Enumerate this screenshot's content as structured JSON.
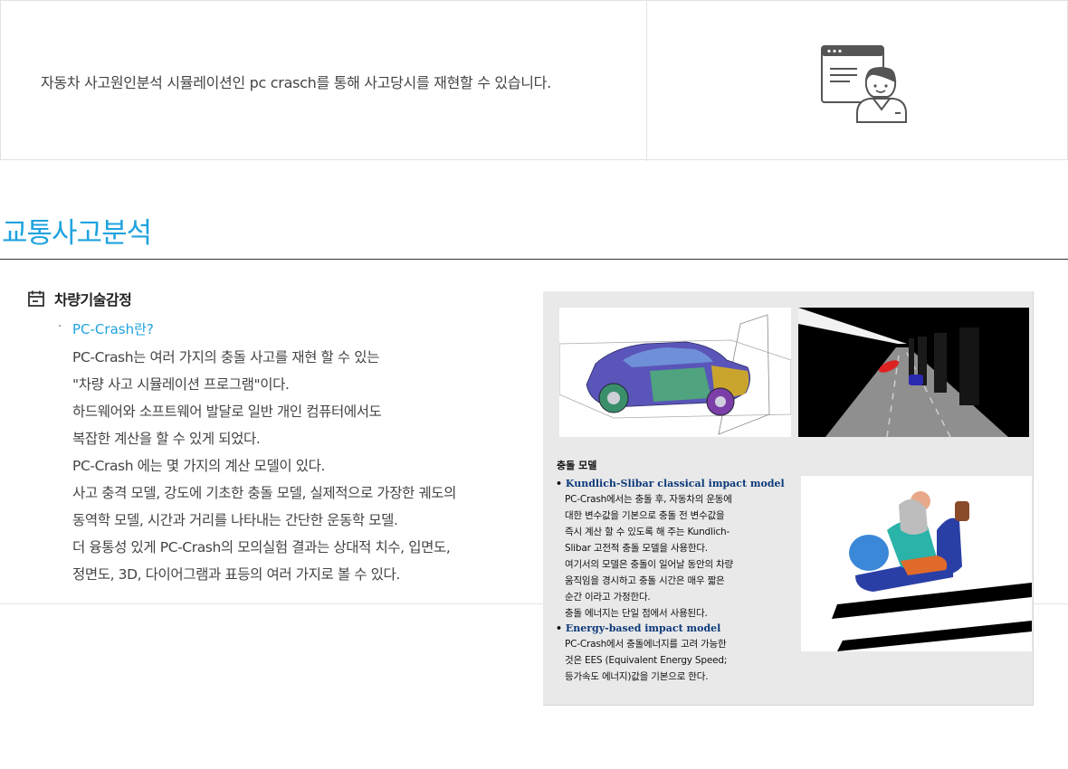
{
  "intro": {
    "text": "자동차 사고원인분석 시뮬레이션인 pc crasch를 통해 사고당시를 재현할 수 있습니다.",
    "icon": "user-screen-icon"
  },
  "section": {
    "title": "교통사고분석",
    "subheading": "차량기술감정",
    "subheading_icon": "calendar-icon",
    "link": "PC-Crash란?",
    "lines": [
      "PC-Crash는 여러 가지의 충돌 사고를 재현 할 수 있는",
      "\"차량 사고 시뮬레이션 프로그램\"이다.",
      "하드웨어와 소프트웨어 발달로 일반 개인 컴퓨터에서도",
      "복잡한 계산을 할 수 있게 되었다.",
      "PC-Crash 에는 몇 가지의 계산 모델이 있다.",
      "사고 충격 모델, 강도에 기초한 충돌 모델, 실제적으로 가장한 궤도의",
      "동역학 모델, 시간과 거리를 나타내는 간단한 운동학 모델.",
      "더 융통성 있게 PC-Crash의 모의실험 결과는 상대적 치수, 입면도,",
      "정면도, 3D, 다이어그램과 표등의 여러 가지로 볼 수 있다."
    ]
  },
  "figure": {
    "title": "충돌 모델",
    "models": [
      {
        "name": "Kundlich-Slibar classical impact model",
        "lines": [
          "PC-Crash에서는 충돌 후, 자동차의 운동에",
          "대한 변수값을 기본으로 충돌 전 변수값을",
          "즉시 계산 할 수 있도록 해 주는 Kundlich-",
          "Slibar 고전적 충돌 모델을 사용한다.",
          "여기서의 모델은 충돌이 일어날 동안의 차량",
          "움직임을 경시하고 충돌 시간은 매우 짧은",
          "순간 이라고 가정한다.",
          "충돌 에너지는 단일 점에서 사용된다."
        ]
      },
      {
        "name": "Energy-based impact model",
        "lines": [
          "PC-Crash에서 충돌에너지를 고려 가능한",
          "것은 EES (Equivalent Energy Speed;",
          "등가속도 에너지)값을 기본으로 한다."
        ]
      }
    ]
  },
  "colors": {
    "accent": "#1fa3df",
    "model_heading": "#0d3a7a",
    "figure_bg": "#e9e9e9"
  }
}
